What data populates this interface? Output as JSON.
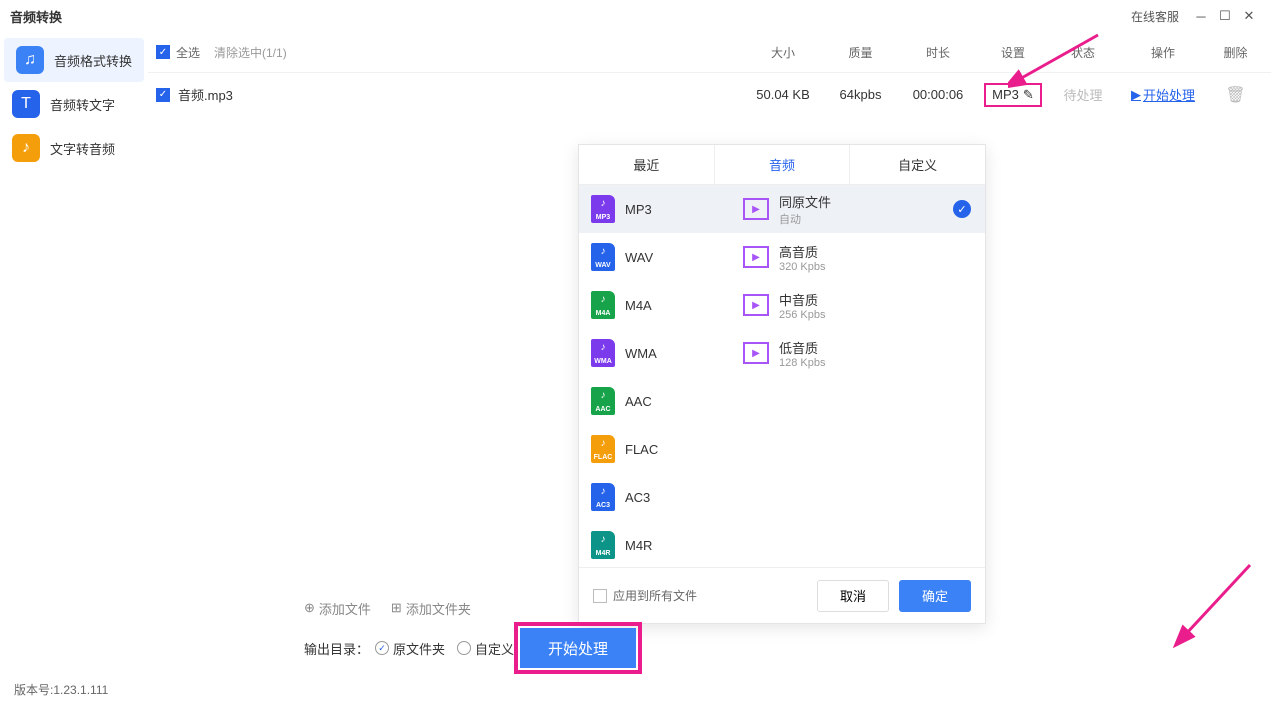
{
  "titlebar": {
    "title": "音频转换",
    "online": "在线客服"
  },
  "sidebar": {
    "items": [
      {
        "label": "音频格式转换"
      },
      {
        "label": "音频转文字"
      },
      {
        "label": "文字转音频"
      }
    ]
  },
  "header": {
    "select_all": "全选",
    "clear": "清除选中(1/1)",
    "cols": {
      "size": "大小",
      "quality": "质量",
      "duration": "时长",
      "settings": "设置",
      "status": "状态",
      "operate": "操作",
      "delete": "删除"
    }
  },
  "file": {
    "name": "音频.mp3",
    "size": "50.04 KB",
    "quality": "64kpbs",
    "duration": "00:00:06",
    "setting": "MP3",
    "status": "待处理",
    "operate": "开始处理"
  },
  "popup": {
    "tabs": [
      "最近",
      "音频",
      "自定义"
    ],
    "formats": [
      "MP3",
      "WAV",
      "M4A",
      "WMA",
      "AAC",
      "FLAC",
      "AC3",
      "M4R"
    ],
    "quality": [
      {
        "title": "同原文件",
        "sub": "自动"
      },
      {
        "title": "高音质",
        "sub": "320 Kpbs"
      },
      {
        "title": "中音质",
        "sub": "256 Kpbs"
      },
      {
        "title": "低音质",
        "sub": "128 Kpbs"
      }
    ],
    "apply_all": "应用到所有文件",
    "cancel": "取消",
    "ok": "确定"
  },
  "bottom": {
    "add_file": "添加文件",
    "add_folder": "添加文件夹"
  },
  "output": {
    "label": "输出目录：",
    "opt1": "原文件夹",
    "opt2": "自定义",
    "start": "开始处理"
  },
  "version": "版本号:1.23.1.111"
}
